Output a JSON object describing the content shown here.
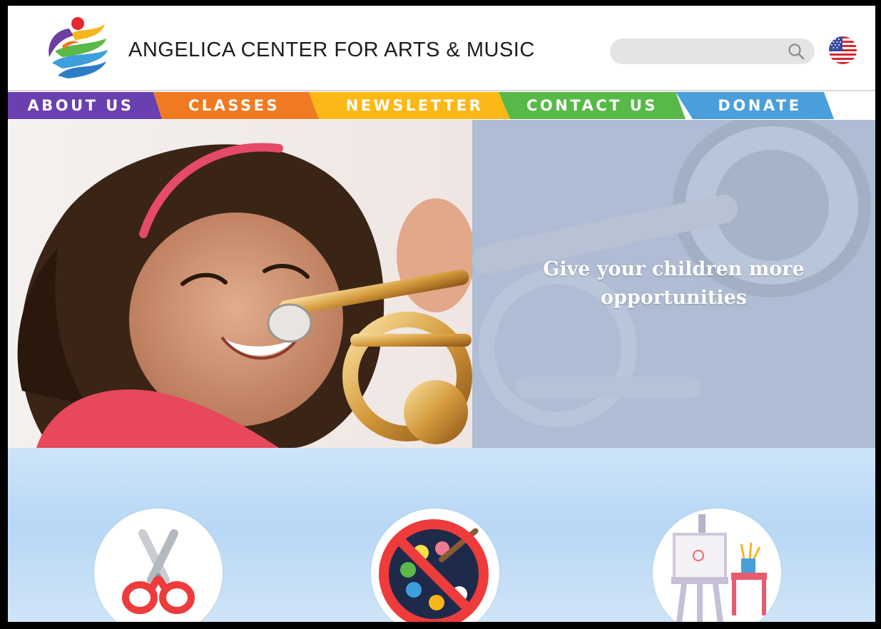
{
  "header": {
    "site_title": "ANGELICA CENTER FOR ARTS & MUSIC",
    "logo_icon": "rainbow-figure-logo",
    "search": {
      "placeholder": "",
      "icon": "search-icon"
    },
    "language_flag": "us-flag-icon"
  },
  "nav": {
    "items": [
      {
        "label": "ABOUT US",
        "color": "#6a3fb0"
      },
      {
        "label": "CLASSES",
        "color": "#f07a21"
      },
      {
        "label": "NEWSLETTER",
        "color": "#fbb816"
      },
      {
        "label": "CONTACT US",
        "color": "#57b947"
      },
      {
        "label": "DONATE",
        "color": "#4a9fdb"
      }
    ]
  },
  "hero": {
    "headline": "Give your children more opportunities",
    "image": "girl-playing-trumpet"
  },
  "features": [
    {
      "icon": "scissors-icon"
    },
    {
      "icon": "no-painting-palette-icon"
    },
    {
      "icon": "easel-art-supplies-icon"
    }
  ]
}
